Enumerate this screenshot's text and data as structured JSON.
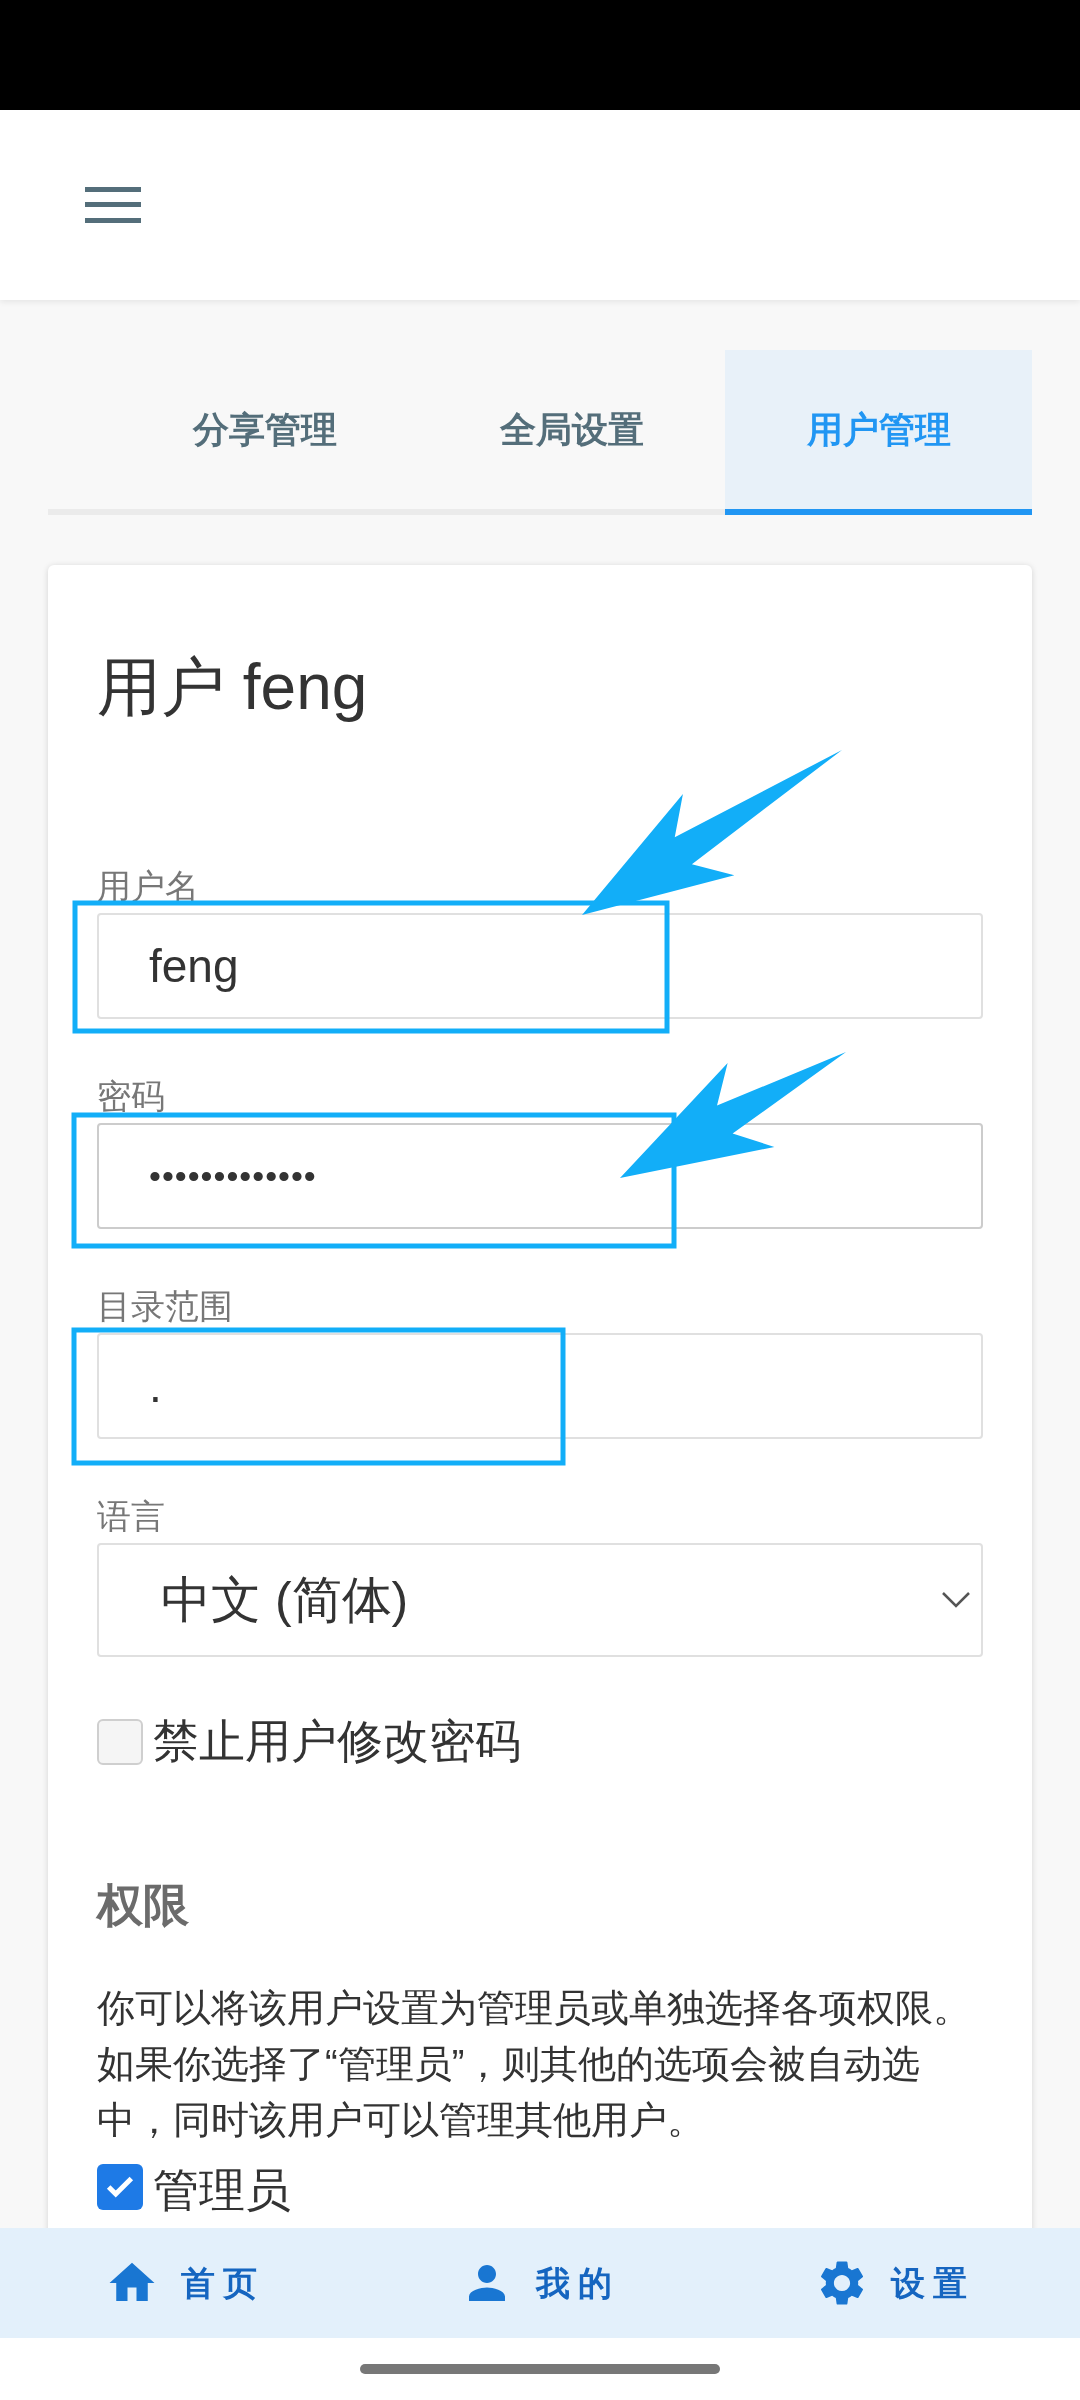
{
  "tabs": [
    {
      "label": "分享管理",
      "selected": false
    },
    {
      "label": "全局设置",
      "selected": false
    },
    {
      "label": "用户管理",
      "selected": true
    }
  ],
  "card": {
    "title": "用户 feng",
    "fields": [
      {
        "kind": "text",
        "label": "用户名",
        "value": "feng"
      },
      {
        "kind": "password",
        "label": "密码",
        "value": "•••••••••••••"
      },
      {
        "kind": "text",
        "label": "目录范围",
        "value": "."
      },
      {
        "kind": "select",
        "label": "语言",
        "value": "中文 (简体)"
      }
    ],
    "lock_password": {
      "label": "禁止用户修改密码",
      "checked": false
    },
    "permissions": {
      "heading": "权限",
      "description": "你可以将该用户设置为管理员或单独选择各项权限。如果你选择了“管理员”，则其他的选项会被自动选中，同时该用户可以管理其他用户。",
      "options": [
        {
          "label": "管理员",
          "checked": true
        }
      ]
    }
  },
  "bottom_nav": [
    {
      "label": "首页"
    },
    {
      "label": "我的"
    },
    {
      "label": "设置"
    }
  ]
}
